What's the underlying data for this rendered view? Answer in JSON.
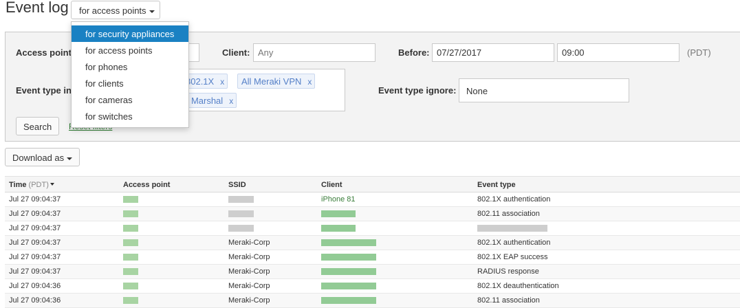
{
  "header": {
    "title": "Event log",
    "filter_button_label": "for access points"
  },
  "dropdown": {
    "items": [
      {
        "label": "for security appliances",
        "active": true
      },
      {
        "label": "for access points",
        "active": false
      },
      {
        "label": "for phones",
        "active": false
      },
      {
        "label": "for clients",
        "active": false
      },
      {
        "label": "for cameras",
        "active": false
      },
      {
        "label": "for switches",
        "active": false
      }
    ]
  },
  "filters": {
    "access_point_label": "Access point",
    "client_label": "Client:",
    "client_placeholder": "Any",
    "before_label": "Before:",
    "before_date": "07/27/2017",
    "before_time": "09:00",
    "timezone": "(PDT)",
    "event_type_include_label": "Event type in",
    "include_tags": [
      {
        "label": "802.1X"
      },
      {
        "label": "All Meraki VPN"
      },
      {
        "label": "r Marshal"
      }
    ],
    "event_type_ignore_label": "Event type ignore:",
    "event_type_ignore_value": "None",
    "search_button": "Search",
    "reset_link": "Reset filters"
  },
  "download_button": "Download as",
  "table": {
    "columns": {
      "time": "Time",
      "time_unit": "(PDT)",
      "access_point": "Access point",
      "ssid": "SSID",
      "client": "Client",
      "event_type": "Event type"
    },
    "rows": [
      {
        "time": "Jul 27 09:04:37",
        "ssid": "",
        "client": "iPhone 81",
        "event_type": "802.1X authentication"
      },
      {
        "time": "Jul 27 09:04:37",
        "ssid": "",
        "client": "",
        "event_type": "802.11 association"
      },
      {
        "time": "Jul 27 09:04:37",
        "ssid": "",
        "client": "",
        "event_type": ""
      },
      {
        "time": "Jul 27 09:04:37",
        "ssid": "Meraki-Corp",
        "client": "",
        "event_type": "802.1X authentication"
      },
      {
        "time": "Jul 27 09:04:37",
        "ssid": "Meraki-Corp",
        "client": "",
        "event_type": "802.1X EAP success"
      },
      {
        "time": "Jul 27 09:04:37",
        "ssid": "Meraki-Corp",
        "client": "",
        "event_type": "RADIUS response"
      },
      {
        "time": "Jul 27 09:04:36",
        "ssid": "Meraki-Corp",
        "client": "",
        "event_type": "802.1X deauthentication"
      },
      {
        "time": "Jul 27 09:04:36",
        "ssid": "Meraki-Corp",
        "client": "",
        "event_type": "802.11 association"
      }
    ]
  },
  "colors": {
    "menu_active": "#1a81c3",
    "tag_text": "#5580c8",
    "link_green": "#2e7d32"
  }
}
